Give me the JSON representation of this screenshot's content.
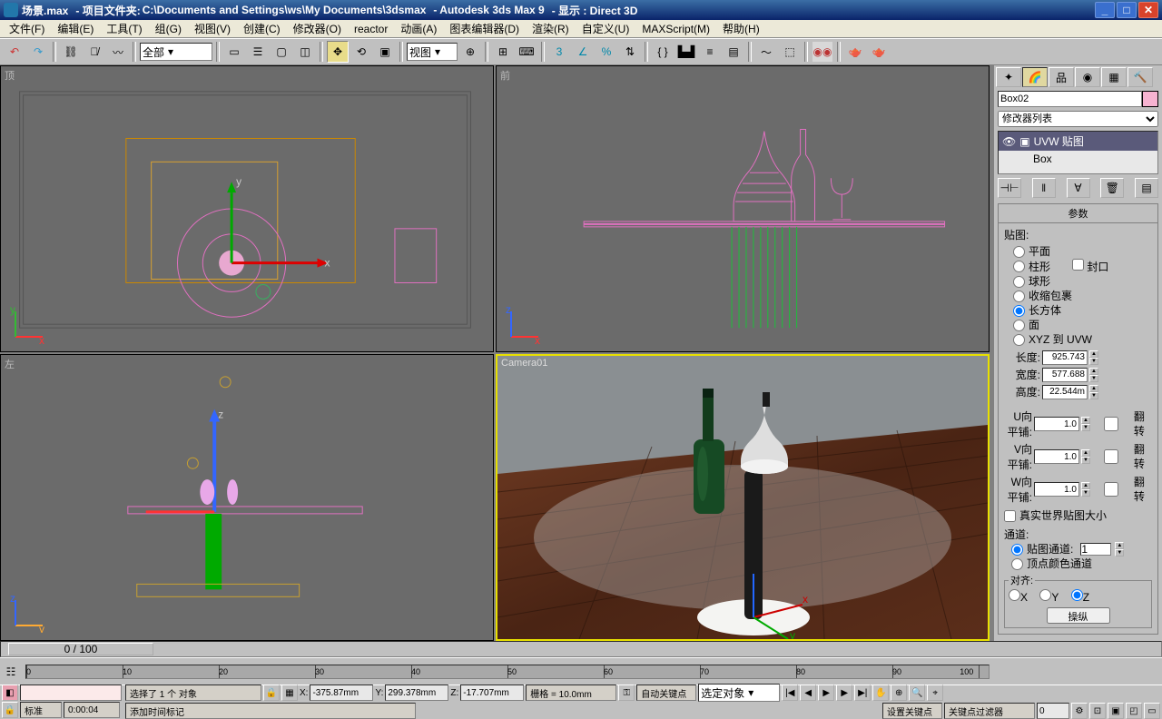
{
  "title": {
    "file": "场景.max",
    "proj_label": "- 项目文件夹: ",
    "proj_path": "C:\\Documents and Settings\\ws\\My Documents\\3dsmax",
    "app": "- Autodesk 3ds Max 9",
    "display": "- 显示 : Direct 3D"
  },
  "menu": [
    "文件(F)",
    "编辑(E)",
    "工具(T)",
    "组(G)",
    "视图(V)",
    "创建(C)",
    "修改器(O)",
    "reactor",
    "动画(A)",
    "图表编辑器(D)",
    "渲染(R)",
    "自定义(U)",
    "MAXScript(M)",
    "帮助(H)"
  ],
  "toolbar": {
    "filter": "全部",
    "viewlabel": "视图"
  },
  "viewports": {
    "top": "顶",
    "front": "前",
    "left": "左",
    "camera": "Camera01"
  },
  "panel": {
    "object": "Box02",
    "modlist": "修改器列表",
    "stack": [
      "UVW 贴图",
      "Box"
    ],
    "param_title": "参数",
    "map_group": "贴图:",
    "maptypes": [
      "平面",
      "柱形",
      "球形",
      "收缩包裹",
      "长方体",
      "面",
      "XYZ 到 UVW"
    ],
    "cap": "封口",
    "dim": {
      "len_l": "长度:",
      "len_v": "925.743",
      "wid_l": "宽度:",
      "wid_v": "577.688",
      "hgt_l": "高度:",
      "hgt_v": "22.544m"
    },
    "tile": {
      "u_l": "U向平铺:",
      "u_v": "1.0",
      "v_l": "V向平铺:",
      "v_v": "1.0",
      "w_l": "W向平铺:",
      "w_v": "1.0",
      "flip": "翻转"
    },
    "realworld": "真实世界贴图大小",
    "channel_group": "通道:",
    "ch_map": "贴图通道:",
    "ch_val": "1",
    "ch_vcol": "顶点颜色通道",
    "align_group": "对齐:",
    "align_x": "X",
    "align_y": "Y",
    "align_z": "Z",
    "fit": "操纵"
  },
  "timeline": {
    "handle": "0 / 100",
    "ticks": [
      "0",
      "10",
      "20",
      "30",
      "40",
      "50",
      "60",
      "70",
      "80",
      "90",
      "100"
    ]
  },
  "status": {
    "sel": "选择了 1 个 对象",
    "x_l": "X:",
    "x_v": "-375.87mm",
    "y_l": "Y:",
    "y_v": "299.378mm",
    "z_l": "Z:",
    "z_v": "-17.707mm",
    "grid": "栅格 = 10.0mm",
    "autokey": "自动关键点",
    "selobj": "选定对象",
    "std": "标准",
    "time": "0:00:04",
    "addtag": "添加时间标记",
    "setkey": "设置关键点",
    "keyfilter": "关键点过滤器"
  }
}
